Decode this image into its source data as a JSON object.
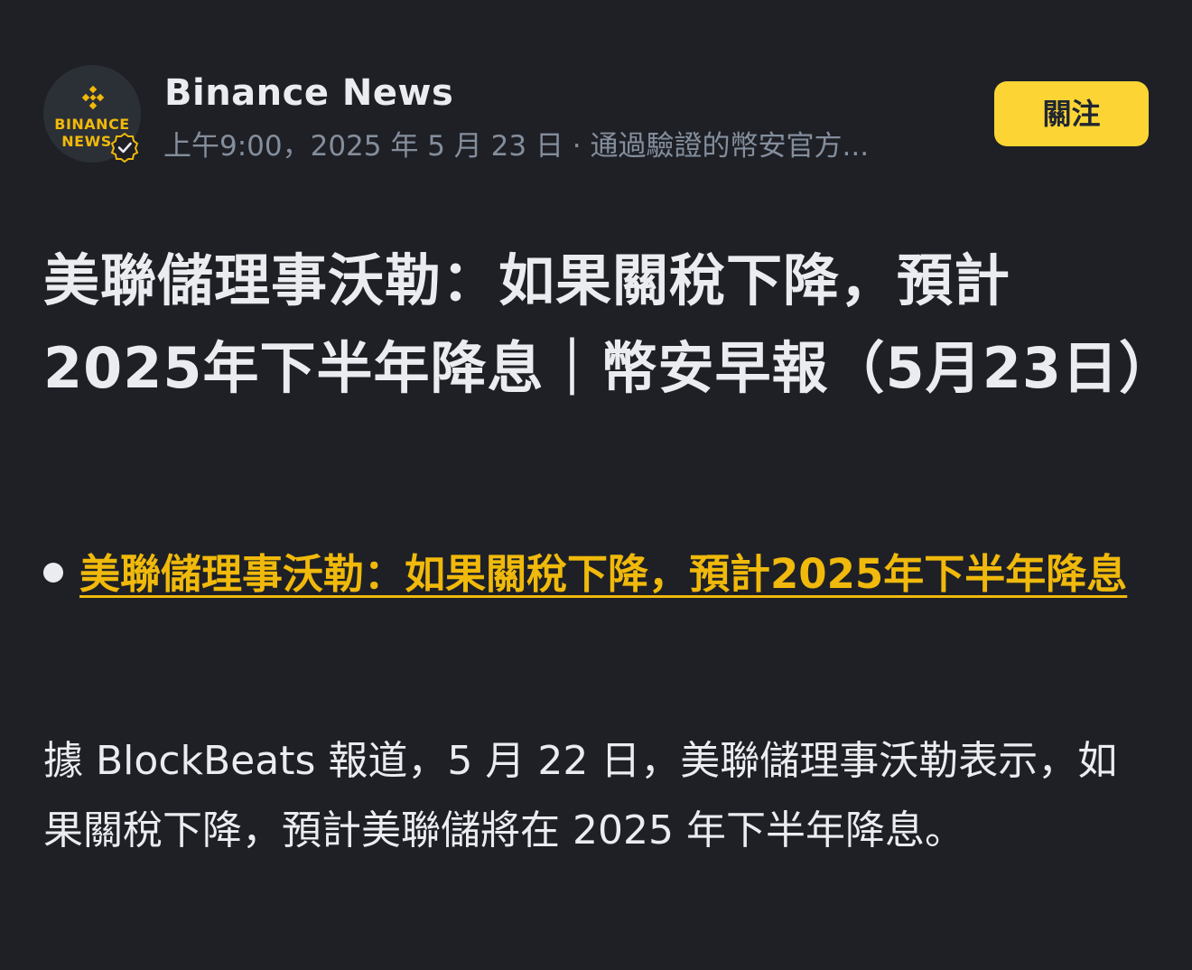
{
  "post": {
    "author": {
      "name": "Binance News",
      "avatar_text_line1": "BINANCE",
      "avatar_text_line2": "NEWS",
      "avatar_icon": "binance-logo-icon",
      "badge_icon": "verified-check-icon"
    },
    "meta": "上午9:00，2025 年 5 月 23 日 · 通過驗證的幣安官方...",
    "follow_label": "關注",
    "title": "美聯儲理事沃勒：如果關稅下降，預計2025年下半年降息｜幣安早報（5月23日）",
    "bullet_link": "美聯儲理事沃勒：如果關稅下降，預計2025年下半年降息",
    "body": "據 BlockBeats 報道，5 月 22 日，美聯儲理事沃勒表示，如果關稅下降，預計美聯儲將在 2025 年下半年降息。"
  },
  "colors": {
    "background": "#1e2026",
    "accent": "#f0b90b",
    "button": "#fcd535",
    "muted": "#848e9c"
  }
}
